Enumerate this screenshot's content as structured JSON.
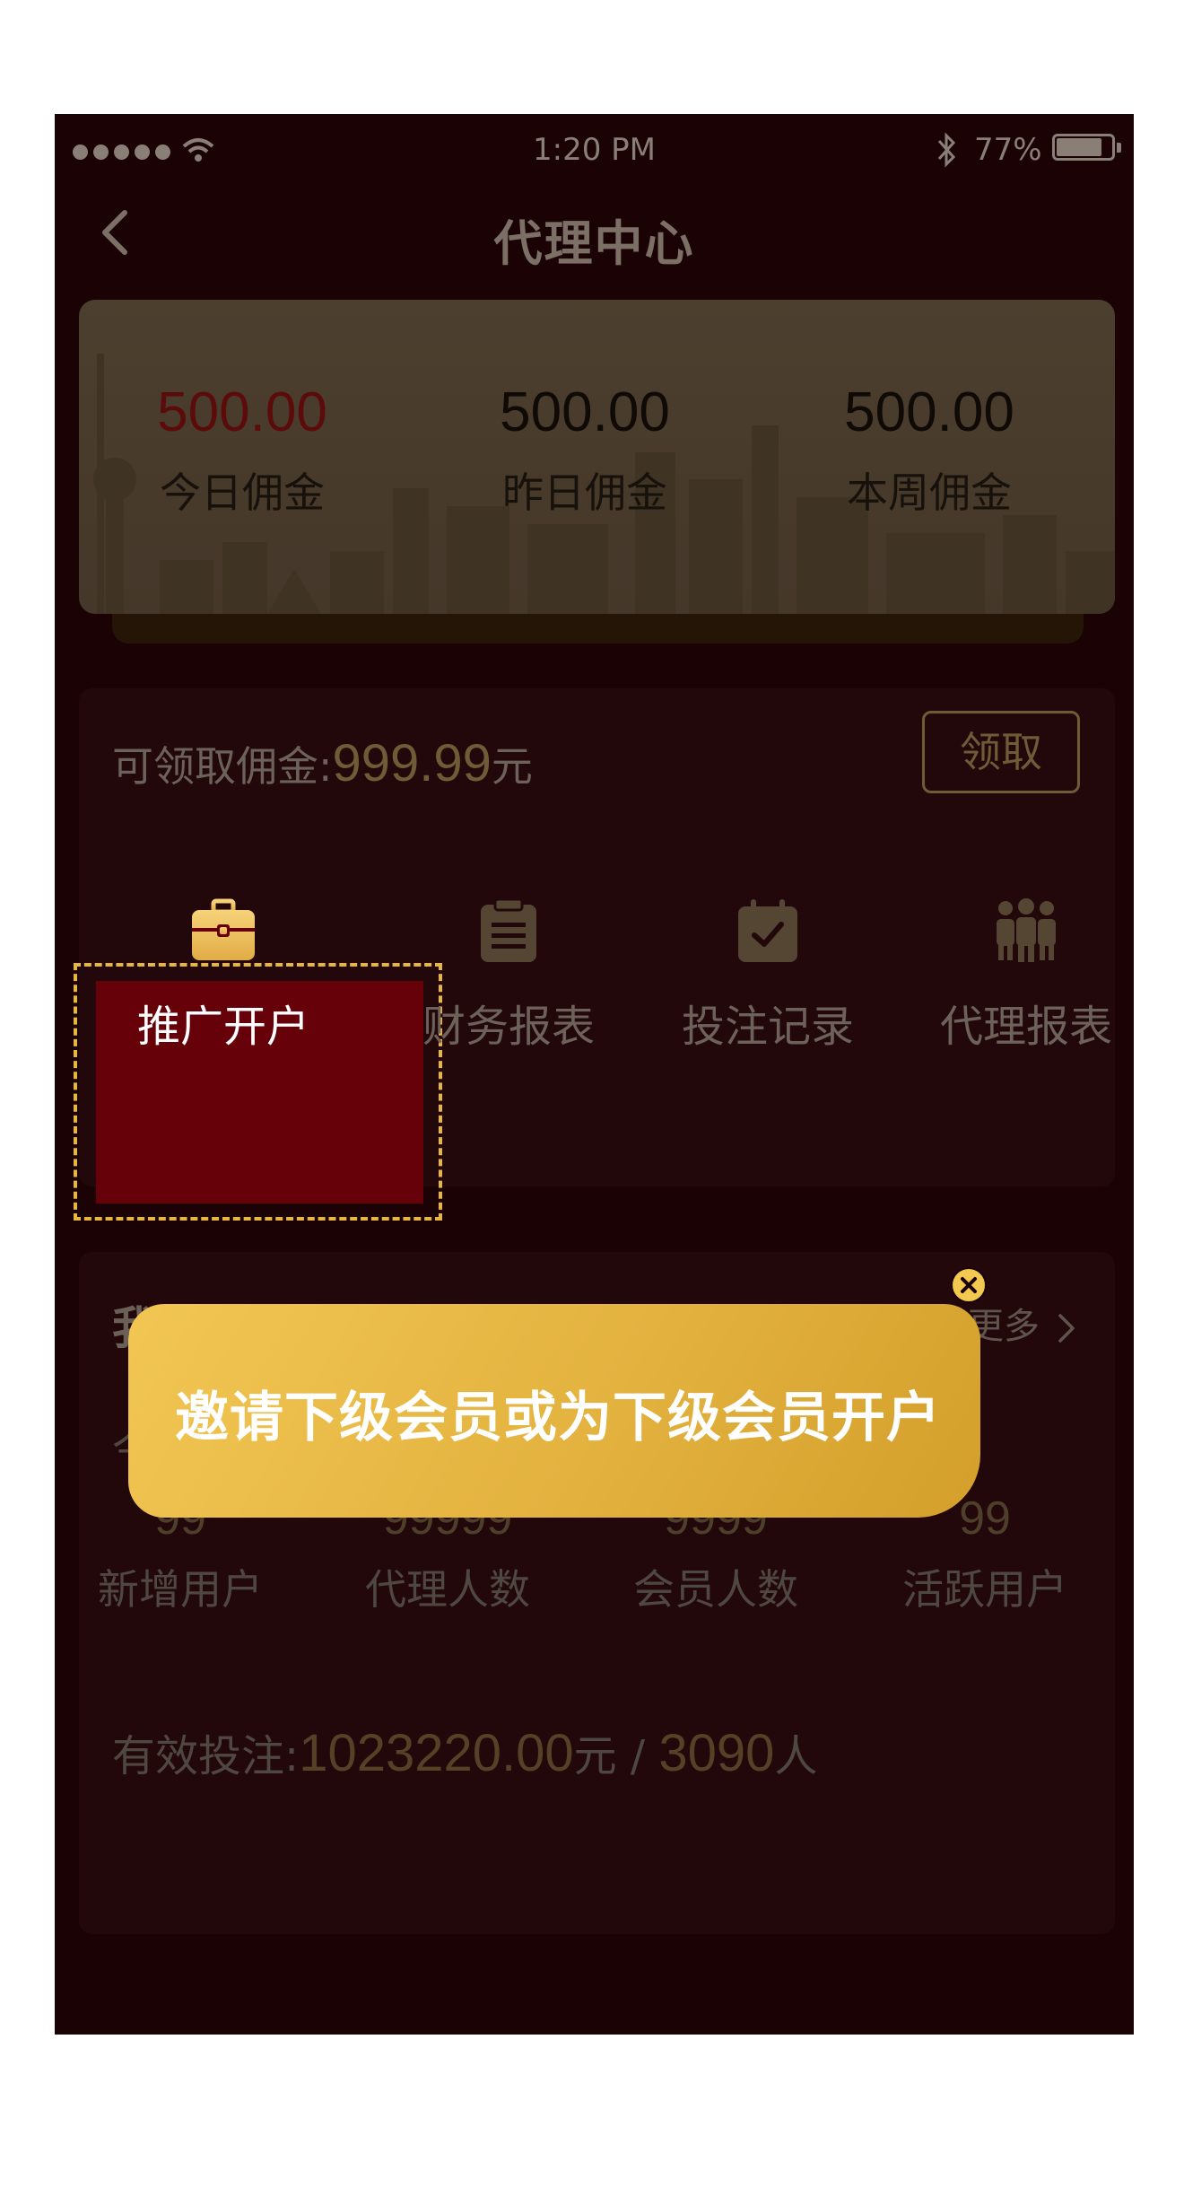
{
  "status_bar": {
    "time": "1:20 PM",
    "battery": "77%"
  },
  "nav": {
    "title": "代理中心"
  },
  "stats": [
    {
      "value": "500.00",
      "label": "今日佣金",
      "color": "#5c0b0b"
    },
    {
      "value": "500.00",
      "label": "昨日佣金"
    },
    {
      "value": "500.00",
      "label": "本周佣金"
    }
  ],
  "commission": {
    "label": "可领取佣金:",
    "amount": "999.99",
    "unit": "元",
    "claim_button": "领取"
  },
  "menu": [
    {
      "label": "推广开户",
      "icon": "briefcase-icon",
      "active": true
    },
    {
      "label": "财务报表",
      "icon": "clipboard-icon"
    },
    {
      "label": "投注记录",
      "icon": "calendar-check-icon"
    },
    {
      "label": "代理报表",
      "icon": "team-icon"
    }
  ],
  "team": {
    "title": "我的团队",
    "more": "查看更多",
    "hidden_label": "今",
    "stats": [
      {
        "value": "99",
        "label": "新增用户"
      },
      {
        "value": "99999",
        "label": "代理人数"
      },
      {
        "value": "9999",
        "label": "会员人数"
      },
      {
        "value": "99",
        "label": "活跃用户"
      }
    ],
    "valid_bet": {
      "label": "有效投注:",
      "amount": "1023220.00",
      "unit1": "元",
      "sep": " / ",
      "people": "3090",
      "unit2": "人"
    }
  },
  "tooltip": {
    "text": "邀请下级会员或为下级会员开户"
  },
  "colors": {
    "accent": "#e7b63e",
    "active_bg": "#660009",
    "background": "#1a0205"
  }
}
